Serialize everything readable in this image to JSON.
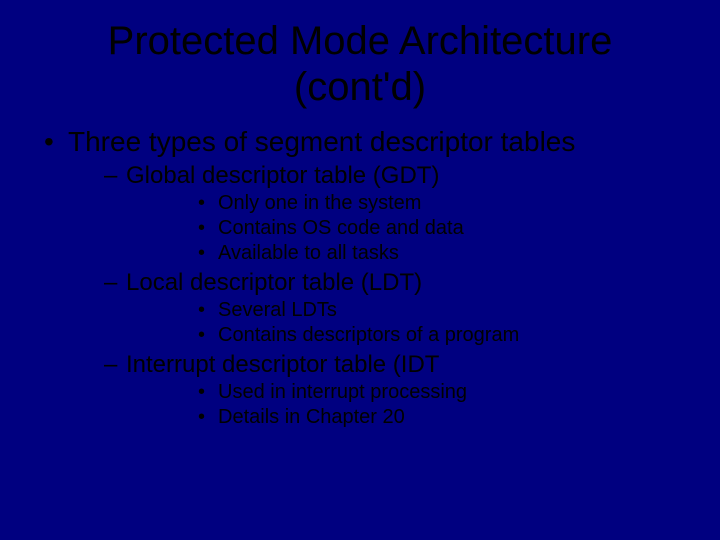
{
  "title_line1": "Protected Mode Architecture",
  "title_line2": "(cont'd)",
  "bullet1": "Three types of segment descriptor tables",
  "sub1": "Global descriptor table (GDT)",
  "sub1_items": {
    "a": "Only one in the system",
    "b": "Contains OS code and data",
    "c": "Available to all tasks"
  },
  "sub2": "Local descriptor table (LDT)",
  "sub2_items": {
    "a": "Several LDTs",
    "b": "Contains descriptors of a program"
  },
  "sub3": "Interrupt descriptor table (IDT",
  "sub3_items": {
    "a": "Used in interrupt processing",
    "b": "Details in Chapter 20"
  }
}
